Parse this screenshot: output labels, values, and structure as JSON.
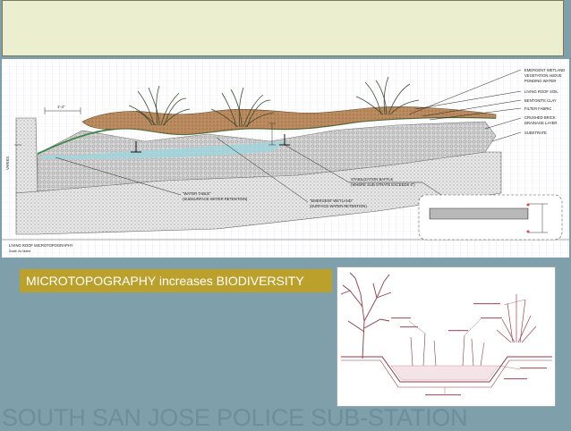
{
  "drawing": {
    "title_line1": "LIVING ROOF MICROTOPOGRAPHY",
    "title_line2": "Scale: As Noted",
    "dim_left": "1'-4\"",
    "dim_side": "VARIES",
    "labels": {
      "emergent_vegetation_1": "EMERGENT WETLAND",
      "emergent_vegetation_2": "VEGETATION ABOVE",
      "emergent_vegetation_3": "PONDING WATER",
      "living_roof_soil": "LIVING ROOF SOIL",
      "bentonite_clay": "BENTONITE CLAY",
      "filter_fabric": "FILTER FABRIC",
      "crushed_brick_1": "CRUSHED BRICK",
      "crushed_brick_2": "DRAINAGE LAYER",
      "substrate": "SUBSTRATE",
      "baffle_1": "STABILIZATION BAFFLE",
      "baffle_2": "(WHERE SUB STRATE EXCEEDS 6\")",
      "water_table_1": "\"WATER TABLE\"",
      "water_table_2": "(SUBSURFACE WATER RETENTION)",
      "emergent_wetland_1": "\"EMERGENT WETLAND\"",
      "emergent_wetland_2": "(SURFACE WATER RETENTION)"
    }
  },
  "caption": "MICROTOPOGRAPHY increases BIODIVERSITY",
  "footer": "SOUTH SAN JOSE POLICE SUB-STATION"
}
